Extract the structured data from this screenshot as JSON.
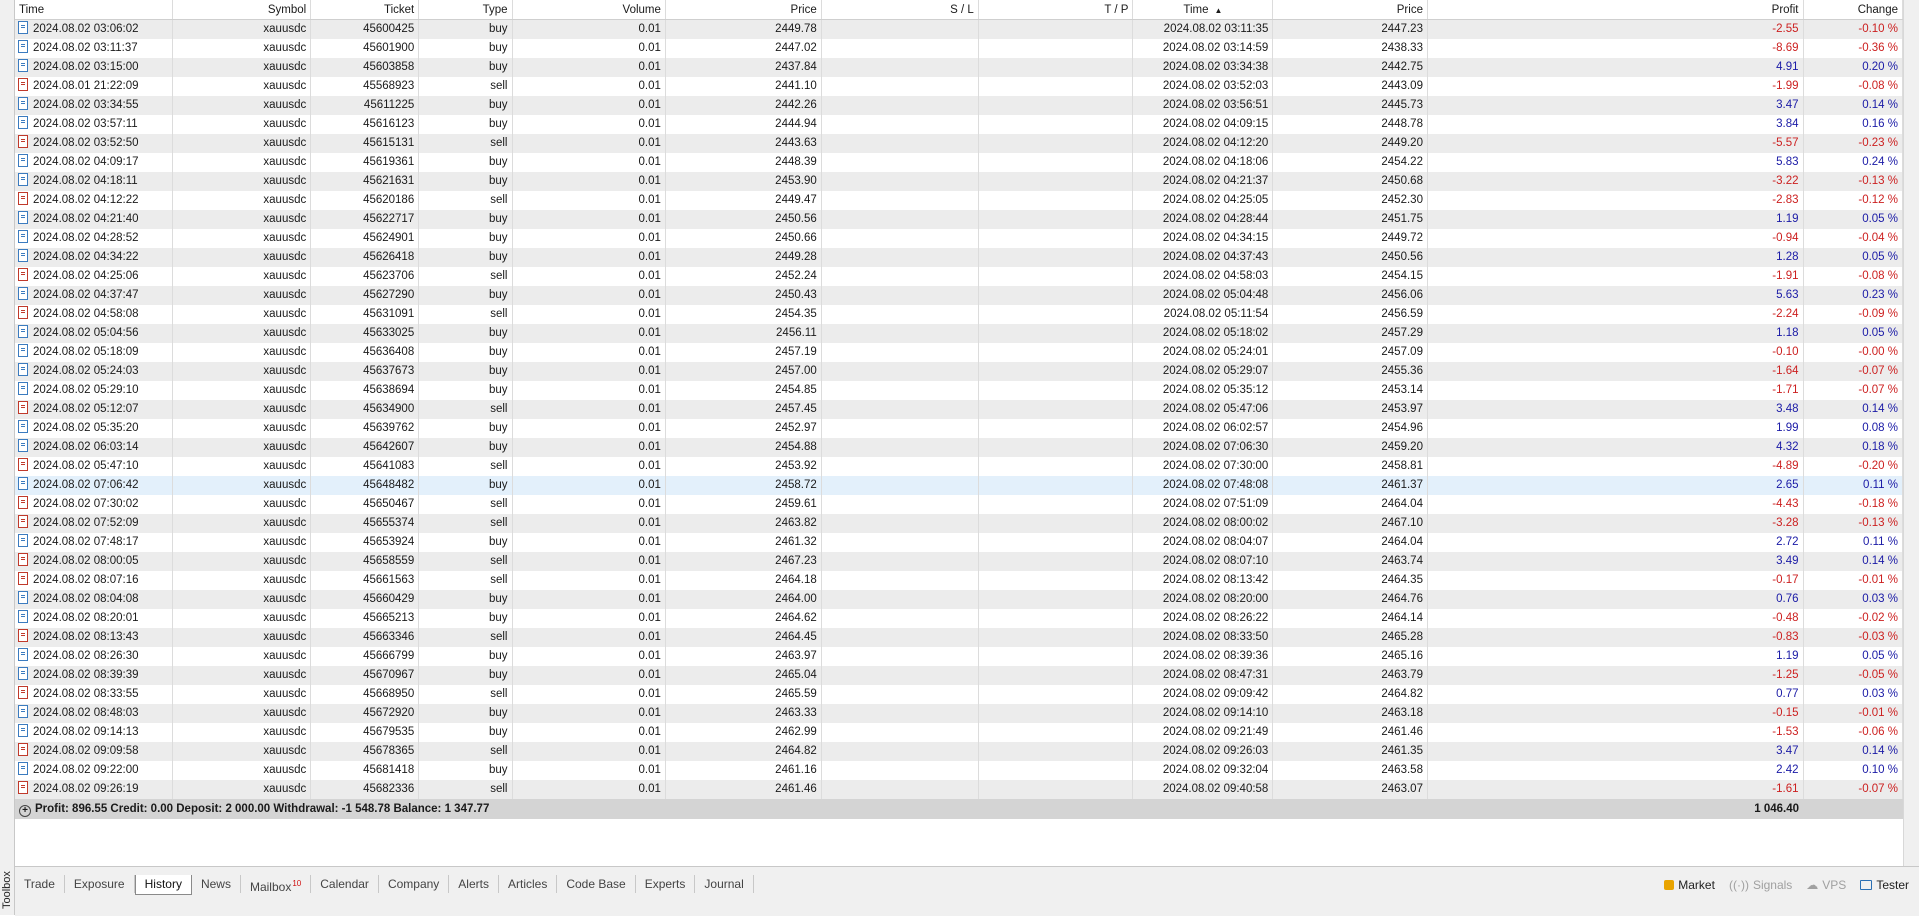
{
  "toolbox": {
    "label": "Toolbox"
  },
  "columns": [
    "Time",
    "Symbol",
    "Ticket",
    "Type",
    "Volume",
    "Price",
    "S / L",
    "T / P",
    "Time",
    "Price",
    "Profit",
    "Change"
  ],
  "rows": [
    [
      "2024.08.02 03:06:02",
      "xauusdc",
      "45600425",
      "buy",
      "0.01",
      "2449.78",
      "",
      "",
      "2024.08.02 03:11:35",
      "2447.23",
      "-2.55",
      "-0.10 %"
    ],
    [
      "2024.08.02 03:11:37",
      "xauusdc",
      "45601900",
      "buy",
      "0.01",
      "2447.02",
      "",
      "",
      "2024.08.02 03:14:59",
      "2438.33",
      "-8.69",
      "-0.36 %"
    ],
    [
      "2024.08.02 03:15:00",
      "xauusdc",
      "45603858",
      "buy",
      "0.01",
      "2437.84",
      "",
      "",
      "2024.08.02 03:34:38",
      "2442.75",
      "4.91",
      "0.20 %"
    ],
    [
      "2024.08.01 21:22:09",
      "xauusdc",
      "45568923",
      "sell",
      "0.01",
      "2441.10",
      "",
      "",
      "2024.08.02 03:52:03",
      "2443.09",
      "-1.99",
      "-0.08 %"
    ],
    [
      "2024.08.02 03:34:55",
      "xauusdc",
      "45611225",
      "buy",
      "0.01",
      "2442.26",
      "",
      "",
      "2024.08.02 03:56:51",
      "2445.73",
      "3.47",
      "0.14 %"
    ],
    [
      "2024.08.02 03:57:11",
      "xauusdc",
      "45616123",
      "buy",
      "0.01",
      "2444.94",
      "",
      "",
      "2024.08.02 04:09:15",
      "2448.78",
      "3.84",
      "0.16 %"
    ],
    [
      "2024.08.02 03:52:50",
      "xauusdc",
      "45615131",
      "sell",
      "0.01",
      "2443.63",
      "",
      "",
      "2024.08.02 04:12:20",
      "2449.20",
      "-5.57",
      "-0.23 %"
    ],
    [
      "2024.08.02 04:09:17",
      "xauusdc",
      "45619361",
      "buy",
      "0.01",
      "2448.39",
      "",
      "",
      "2024.08.02 04:18:06",
      "2454.22",
      "5.83",
      "0.24 %"
    ],
    [
      "2024.08.02 04:18:11",
      "xauusdc",
      "45621631",
      "buy",
      "0.01",
      "2453.90",
      "",
      "",
      "2024.08.02 04:21:37",
      "2450.68",
      "-3.22",
      "-0.13 %"
    ],
    [
      "2024.08.02 04:12:22",
      "xauusdc",
      "45620186",
      "sell",
      "0.01",
      "2449.47",
      "",
      "",
      "2024.08.02 04:25:05",
      "2452.30",
      "-2.83",
      "-0.12 %"
    ],
    [
      "2024.08.02 04:21:40",
      "xauusdc",
      "45622717",
      "buy",
      "0.01",
      "2450.56",
      "",
      "",
      "2024.08.02 04:28:44",
      "2451.75",
      "1.19",
      "0.05 %"
    ],
    [
      "2024.08.02 04:28:52",
      "xauusdc",
      "45624901",
      "buy",
      "0.01",
      "2450.66",
      "",
      "",
      "2024.08.02 04:34:15",
      "2449.72",
      "-0.94",
      "-0.04 %"
    ],
    [
      "2024.08.02 04:34:22",
      "xauusdc",
      "45626418",
      "buy",
      "0.01",
      "2449.28",
      "",
      "",
      "2024.08.02 04:37:43",
      "2450.56",
      "1.28",
      "0.05 %"
    ],
    [
      "2024.08.02 04:25:06",
      "xauusdc",
      "45623706",
      "sell",
      "0.01",
      "2452.24",
      "",
      "",
      "2024.08.02 04:58:03",
      "2454.15",
      "-1.91",
      "-0.08 %"
    ],
    [
      "2024.08.02 04:37:47",
      "xauusdc",
      "45627290",
      "buy",
      "0.01",
      "2450.43",
      "",
      "",
      "2024.08.02 05:04:48",
      "2456.06",
      "5.63",
      "0.23 %"
    ],
    [
      "2024.08.02 04:58:08",
      "xauusdc",
      "45631091",
      "sell",
      "0.01",
      "2454.35",
      "",
      "",
      "2024.08.02 05:11:54",
      "2456.59",
      "-2.24",
      "-0.09 %"
    ],
    [
      "2024.08.02 05:04:56",
      "xauusdc",
      "45633025",
      "buy",
      "0.01",
      "2456.11",
      "",
      "",
      "2024.08.02 05:18:02",
      "2457.29",
      "1.18",
      "0.05 %"
    ],
    [
      "2024.08.02 05:18:09",
      "xauusdc",
      "45636408",
      "buy",
      "0.01",
      "2457.19",
      "",
      "",
      "2024.08.02 05:24:01",
      "2457.09",
      "-0.10",
      "-0.00 %"
    ],
    [
      "2024.08.02 05:24:03",
      "xauusdc",
      "45637673",
      "buy",
      "0.01",
      "2457.00",
      "",
      "",
      "2024.08.02 05:29:07",
      "2455.36",
      "-1.64",
      "-0.07 %"
    ],
    [
      "2024.08.02 05:29:10",
      "xauusdc",
      "45638694",
      "buy",
      "0.01",
      "2454.85",
      "",
      "",
      "2024.08.02 05:35:12",
      "2453.14",
      "-1.71",
      "-0.07 %"
    ],
    [
      "2024.08.02 05:12:07",
      "xauusdc",
      "45634900",
      "sell",
      "0.01",
      "2457.45",
      "",
      "",
      "2024.08.02 05:47:06",
      "2453.97",
      "3.48",
      "0.14 %"
    ],
    [
      "2024.08.02 05:35:20",
      "xauusdc",
      "45639762",
      "buy",
      "0.01",
      "2452.97",
      "",
      "",
      "2024.08.02 06:02:57",
      "2454.96",
      "1.99",
      "0.08 %"
    ],
    [
      "2024.08.02 06:03:14",
      "xauusdc",
      "45642607",
      "buy",
      "0.01",
      "2454.88",
      "",
      "",
      "2024.08.02 07:06:30",
      "2459.20",
      "4.32",
      "0.18 %"
    ],
    [
      "2024.08.02 05:47:10",
      "xauusdc",
      "45641083",
      "sell",
      "0.01",
      "2453.92",
      "",
      "",
      "2024.08.02 07:30:00",
      "2458.81",
      "-4.89",
      "-0.20 %"
    ],
    [
      "2024.08.02 07:06:42",
      "xauusdc",
      "45648482",
      "buy",
      "0.01",
      "2458.72",
      "",
      "",
      "2024.08.02 07:48:08",
      "2461.37",
      "2.65",
      "0.11 %"
    ],
    [
      "2024.08.02 07:30:02",
      "xauusdc",
      "45650467",
      "sell",
      "0.01",
      "2459.61",
      "",
      "",
      "2024.08.02 07:51:09",
      "2464.04",
      "-4.43",
      "-0.18 %"
    ],
    [
      "2024.08.02 07:52:09",
      "xauusdc",
      "45655374",
      "sell",
      "0.01",
      "2463.82",
      "",
      "",
      "2024.08.02 08:00:02",
      "2467.10",
      "-3.28",
      "-0.13 %"
    ],
    [
      "2024.08.02 07:48:17",
      "xauusdc",
      "45653924",
      "buy",
      "0.01",
      "2461.32",
      "",
      "",
      "2024.08.02 08:04:07",
      "2464.04",
      "2.72",
      "0.11 %"
    ],
    [
      "2024.08.02 08:00:05",
      "xauusdc",
      "45658559",
      "sell",
      "0.01",
      "2467.23",
      "",
      "",
      "2024.08.02 08:07:10",
      "2463.74",
      "3.49",
      "0.14 %"
    ],
    [
      "2024.08.02 08:07:16",
      "xauusdc",
      "45661563",
      "sell",
      "0.01",
      "2464.18",
      "",
      "",
      "2024.08.02 08:13:42",
      "2464.35",
      "-0.17",
      "-0.01 %"
    ],
    [
      "2024.08.02 08:04:08",
      "xauusdc",
      "45660429",
      "buy",
      "0.01",
      "2464.00",
      "",
      "",
      "2024.08.02 08:20:00",
      "2464.76",
      "0.76",
      "0.03 %"
    ],
    [
      "2024.08.02 08:20:01",
      "xauusdc",
      "45665213",
      "buy",
      "0.01",
      "2464.62",
      "",
      "",
      "2024.08.02 08:26:22",
      "2464.14",
      "-0.48",
      "-0.02 %"
    ],
    [
      "2024.08.02 08:13:43",
      "xauusdc",
      "45663346",
      "sell",
      "0.01",
      "2464.45",
      "",
      "",
      "2024.08.02 08:33:50",
      "2465.28",
      "-0.83",
      "-0.03 %"
    ],
    [
      "2024.08.02 08:26:30",
      "xauusdc",
      "45666799",
      "buy",
      "0.01",
      "2463.97",
      "",
      "",
      "2024.08.02 08:39:36",
      "2465.16",
      "1.19",
      "0.05 %"
    ],
    [
      "2024.08.02 08:39:39",
      "xauusdc",
      "45670967",
      "buy",
      "0.01",
      "2465.04",
      "",
      "",
      "2024.08.02 08:47:31",
      "2463.79",
      "-1.25",
      "-0.05 %"
    ],
    [
      "2024.08.02 08:33:55",
      "xauusdc",
      "45668950",
      "sell",
      "0.01",
      "2465.59",
      "",
      "",
      "2024.08.02 09:09:42",
      "2464.82",
      "0.77",
      "0.03 %"
    ],
    [
      "2024.08.02 08:48:03",
      "xauusdc",
      "45672920",
      "buy",
      "0.01",
      "2463.33",
      "",
      "",
      "2024.08.02 09:14:10",
      "2463.18",
      "-0.15",
      "-0.01 %"
    ],
    [
      "2024.08.02 09:14:13",
      "xauusdc",
      "45679535",
      "buy",
      "0.01",
      "2462.99",
      "",
      "",
      "2024.08.02 09:21:49",
      "2461.46",
      "-1.53",
      "-0.06 %"
    ],
    [
      "2024.08.02 09:09:58",
      "xauusdc",
      "45678365",
      "sell",
      "0.01",
      "2464.82",
      "",
      "",
      "2024.08.02 09:26:03",
      "2461.35",
      "3.47",
      "0.14 %"
    ],
    [
      "2024.08.02 09:22:00",
      "xauusdc",
      "45681418",
      "buy",
      "0.01",
      "2461.16",
      "",
      "",
      "2024.08.02 09:32:04",
      "2463.58",
      "2.42",
      "0.10 %"
    ],
    [
      "2024.08.02 09:26:19",
      "xauusdc",
      "45682336",
      "sell",
      "0.01",
      "2461.46",
      "",
      "",
      "2024.08.02 09:40:58",
      "2463.07",
      "-1.61",
      "-0.07 %"
    ]
  ],
  "selected_row": 24,
  "summary": {
    "text": "Profit: 896.55  Credit: 0.00  Deposit: 2 000.00  Withdrawal: -1 548.78  Balance: 1 347.77",
    "total": "1 046.40"
  },
  "tabs": [
    {
      "label": "Trade"
    },
    {
      "label": "Exposure"
    },
    {
      "label": "History",
      "active": true
    },
    {
      "label": "News"
    },
    {
      "label": "Mailbox",
      "badge": "10"
    },
    {
      "label": "Calendar"
    },
    {
      "label": "Company"
    },
    {
      "label": "Alerts"
    },
    {
      "label": "Articles"
    },
    {
      "label": "Code Base"
    },
    {
      "label": "Experts"
    },
    {
      "label": "Journal"
    }
  ],
  "status": {
    "market": "Market",
    "signals": "Signals",
    "vps": "VPS",
    "tester": "Tester"
  },
  "colors": {
    "positive": "#1a1aa6",
    "negative": "#cc1f1f",
    "selected": "#e3f0fb"
  }
}
